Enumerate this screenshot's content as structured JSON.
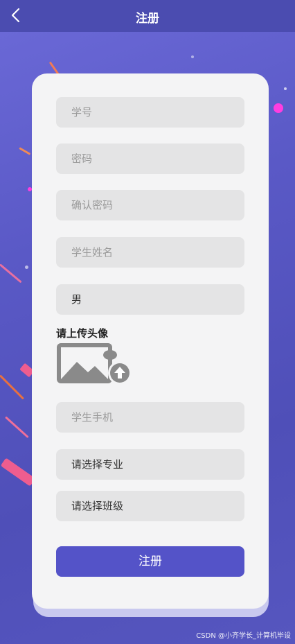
{
  "header": {
    "title": "注册",
    "back_icon": "chevron-left-icon"
  },
  "form": {
    "student_id_placeholder": "学号",
    "password_placeholder": "密码",
    "confirm_password_placeholder": "确认密码",
    "student_name_placeholder": "学生姓名",
    "gender_value": "男",
    "avatar_label": "请上传头像",
    "avatar_icon": "image-upload-icon",
    "phone_placeholder": "学生手机",
    "major_select": "请选择专业",
    "class_select": "请选择班级",
    "submit_label": "注册"
  },
  "watermark": "CSDN @小齐学长_计算机毕设",
  "colors": {
    "header": "#4b4cb0",
    "background": "#5a59c6",
    "card": "#f4f4f5",
    "field": "#e4e4e5",
    "button": "#5453c8"
  }
}
